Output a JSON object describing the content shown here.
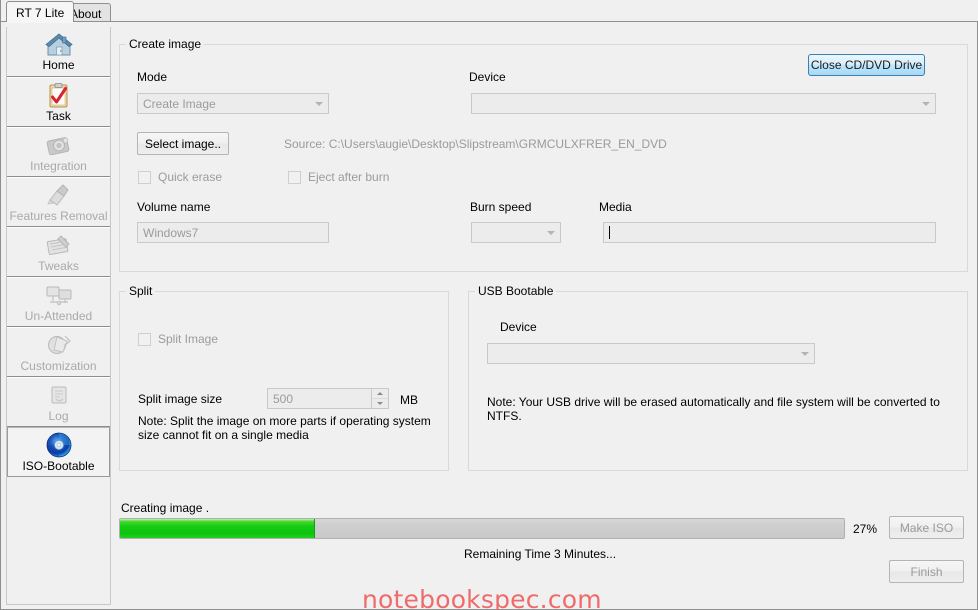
{
  "window": {
    "tabs": [
      {
        "label": "RT 7 Lite",
        "active": true
      },
      {
        "label": "About",
        "active": false
      }
    ]
  },
  "sidebar": {
    "items": [
      {
        "label": "Home",
        "icon": "home-icon",
        "state": "normal"
      },
      {
        "label": "Task",
        "icon": "clipboard-check-icon",
        "state": "normal"
      },
      {
        "label": "Integration",
        "icon": "camera-icon",
        "state": "disabled"
      },
      {
        "label": "Features Removal",
        "icon": "broom-icon",
        "state": "disabled"
      },
      {
        "label": "Tweaks",
        "icon": "tools-icon",
        "state": "disabled"
      },
      {
        "label": "Un-Attended",
        "icon": "monitors-icon",
        "state": "disabled"
      },
      {
        "label": "Customization",
        "icon": "palette-icon",
        "state": "disabled"
      },
      {
        "label": "Log",
        "icon": "log-icon",
        "state": "disabled"
      },
      {
        "label": "ISO-Bootable",
        "icon": "disc-icon",
        "state": "selected"
      }
    ]
  },
  "create_image": {
    "legend": "Create image",
    "mode_label": "Mode",
    "mode_value": "Create Image",
    "device_label": "Device",
    "device_value": "",
    "close_drive_button": "Close CD/DVD Drive",
    "select_image_button": "Select image..",
    "source_text": "Source: C:\\Users\\augie\\Desktop\\Slipstream\\GRMCULXFRER_EN_DVD",
    "quick_erase_label": "Quick erase",
    "quick_erase_checked": false,
    "eject_after_burn_label": "Eject after burn",
    "eject_after_burn_checked": false,
    "volume_name_label": "Volume name",
    "volume_name_value": "Windows7",
    "burn_speed_label": "Burn speed",
    "burn_speed_value": "",
    "media_label": "Media",
    "media_value": ""
  },
  "split": {
    "legend": "Split",
    "split_image_label": "Split Image",
    "split_image_checked": false,
    "split_size_label": "Split image size",
    "split_size_value": "500",
    "split_size_units": "MB",
    "note": "Note: Split the image on more parts if operating system size cannot fit on a single media"
  },
  "usb_bootable": {
    "legend": "USB Bootable",
    "device_label": "Device",
    "device_value": "",
    "note": "Note: Your USB drive will be erased automatically and file system will be converted to NTFS."
  },
  "status": {
    "operation_text": "Creating image .",
    "percent_label": "27%",
    "percent_value": 27,
    "remaining_time": "Remaining Time 3 Minutes...",
    "make_iso_button": "Make ISO",
    "finish_button": "Finish"
  },
  "watermark": {
    "text": "notebookspec.com"
  },
  "colors": {
    "progress_green": "#14cc14",
    "accent_blue": "#3c7fb1",
    "watermark_red": "#ef6b6b"
  }
}
